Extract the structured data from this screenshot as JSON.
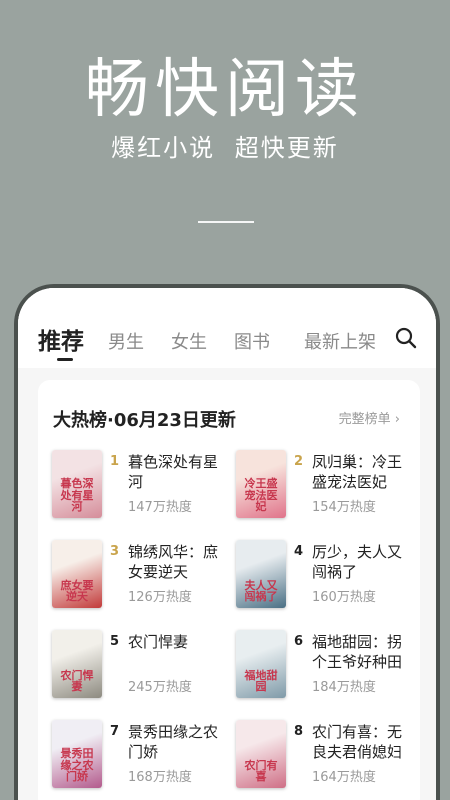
{
  "hero": {
    "title": "畅快阅读",
    "subtitle": "爆红小说  超快更新"
  },
  "tabs": [
    {
      "label": "推荐",
      "active": true
    },
    {
      "label": "男生",
      "active": false
    },
    {
      "label": "女生",
      "active": false
    },
    {
      "label": "图书",
      "active": false
    },
    {
      "label": "最新上架",
      "active": false
    }
  ],
  "ranking": {
    "title": "大热榜·06月23日更新",
    "more_label": "完整榜单 ›",
    "books": [
      {
        "rank": "1",
        "name": "暮色深处有星河",
        "heat": "147万热度",
        "cover_text": "暮色深处有星河",
        "rank_color": "#c9a44c",
        "cover_colors": [
          "#f3e2e4",
          "#d58d9a"
        ]
      },
      {
        "rank": "2",
        "name": "凤归巢：冷王盛宠法医妃",
        "heat": "154万热度",
        "cover_text": "冷王盛宠法医妃",
        "rank_color": "#c9a44c",
        "cover_colors": [
          "#f7e3dc",
          "#e0738a"
        ]
      },
      {
        "rank": "3",
        "name": "锦绣风华：庶女要逆天",
        "heat": "126万热度",
        "cover_text": "庶女要逆天",
        "rank_color": "#c9a44c",
        "cover_colors": [
          "#f7efe9",
          "#c23a3a"
        ]
      },
      {
        "rank": "4",
        "name": "厉少，夫人又闯祸了",
        "heat": "160万热度",
        "cover_text": "夫人又闯祸了",
        "rank_color": "#222222",
        "cover_colors": [
          "#e7ecef",
          "#4a6f84"
        ]
      },
      {
        "rank": "5",
        "name": "农门悍妻",
        "heat": "245万热度",
        "cover_text": "农门悍妻",
        "rank_color": "#222222",
        "cover_colors": [
          "#f2f0ea",
          "#8d8a80"
        ]
      },
      {
        "rank": "6",
        "name": "福地甜园：拐个王爷好种田",
        "heat": "184万热度",
        "cover_text": "福地甜园",
        "rank_color": "#222222",
        "cover_colors": [
          "#e8eef0",
          "#7f9aa8"
        ]
      },
      {
        "rank": "7",
        "name": "景秀田缘之农门娇",
        "heat": "168万热度",
        "cover_text": "景秀田缘之农门娇",
        "rank_color": "#222222",
        "cover_colors": [
          "#f0eef4",
          "#b35a8c"
        ]
      },
      {
        "rank": "8",
        "name": "农门有喜：无良夫君俏媳妇",
        "heat": "164万热度",
        "cover_text": "农门有喜",
        "rank_color": "#222222",
        "cover_colors": [
          "#f6e8ea",
          "#cf6f86"
        ]
      }
    ]
  }
}
